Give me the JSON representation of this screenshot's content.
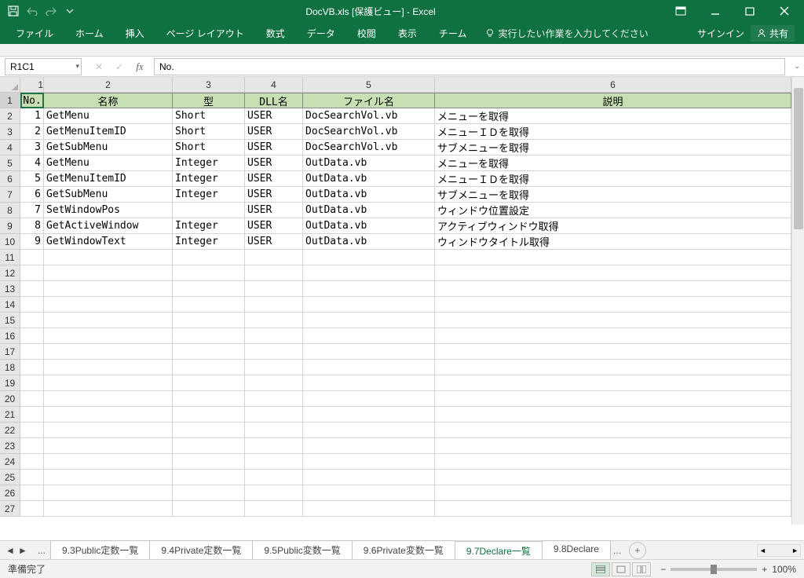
{
  "titlebar": {
    "title": "DocVB.xls  [保護ビュー] - Excel"
  },
  "ribbon": {
    "tabs": [
      "ファイル",
      "ホーム",
      "挿入",
      "ページ レイアウト",
      "数式",
      "データ",
      "校閲",
      "表示",
      "チーム"
    ],
    "tellme": "実行したい作業を入力してください",
    "signin": "サインイン",
    "share": "共有"
  },
  "formulabar": {
    "namebox": "R1C1",
    "formula": "No."
  },
  "columns": {
    "labels": [
      "1",
      "2",
      "3",
      "4",
      "5",
      "6"
    ]
  },
  "header": [
    "No.",
    "名称",
    "型",
    "DLL名",
    "ファイル名",
    "説明"
  ],
  "rows": [
    {
      "no": "1",
      "name": "GetMenu",
      "type": "Short",
      "dll": "USER",
      "file": "DocSearchVol.vb",
      "desc": "メニューを取得"
    },
    {
      "no": "2",
      "name": "GetMenuItemID",
      "type": "Short",
      "dll": "USER",
      "file": "DocSearchVol.vb",
      "desc": "メニューＩＤを取得"
    },
    {
      "no": "3",
      "name": "GetSubMenu",
      "type": "Short",
      "dll": "USER",
      "file": "DocSearchVol.vb",
      "desc": "サブメニューを取得"
    },
    {
      "no": "4",
      "name": "GetMenu",
      "type": "Integer",
      "dll": "USER",
      "file": "OutData.vb",
      "desc": "メニューを取得"
    },
    {
      "no": "5",
      "name": "GetMenuItemID",
      "type": "Integer",
      "dll": "USER",
      "file": "OutData.vb",
      "desc": "メニューＩＤを取得"
    },
    {
      "no": "6",
      "name": "GetSubMenu",
      "type": "Integer",
      "dll": "USER",
      "file": "OutData.vb",
      "desc": "サブメニューを取得"
    },
    {
      "no": "7",
      "name": "SetWindowPos",
      "type": "",
      "dll": "USER",
      "file": "OutData.vb",
      "desc": "ウィンドウ位置設定"
    },
    {
      "no": "8",
      "name": "GetActiveWindow",
      "type": "Integer",
      "dll": "USER",
      "file": "OutData.vb",
      "desc": "アクティブウィンドウ取得"
    },
    {
      "no": "9",
      "name": "GetWindowText",
      "type": "Integer",
      "dll": "USER",
      "file": "OutData.vb",
      "desc": "ウィンドウタイトル取得"
    }
  ],
  "empty_row_count": 17,
  "sheets": {
    "tabs": [
      "9.3Public定数一覧",
      "9.4Private定数一覧",
      "9.5Public変数一覧",
      "9.6Private変数一覧",
      "9.7Declare一覧",
      "9.8Declare"
    ],
    "active_index": 4,
    "more": "..."
  },
  "statusbar": {
    "status": "準備完了",
    "zoom": "100%"
  }
}
